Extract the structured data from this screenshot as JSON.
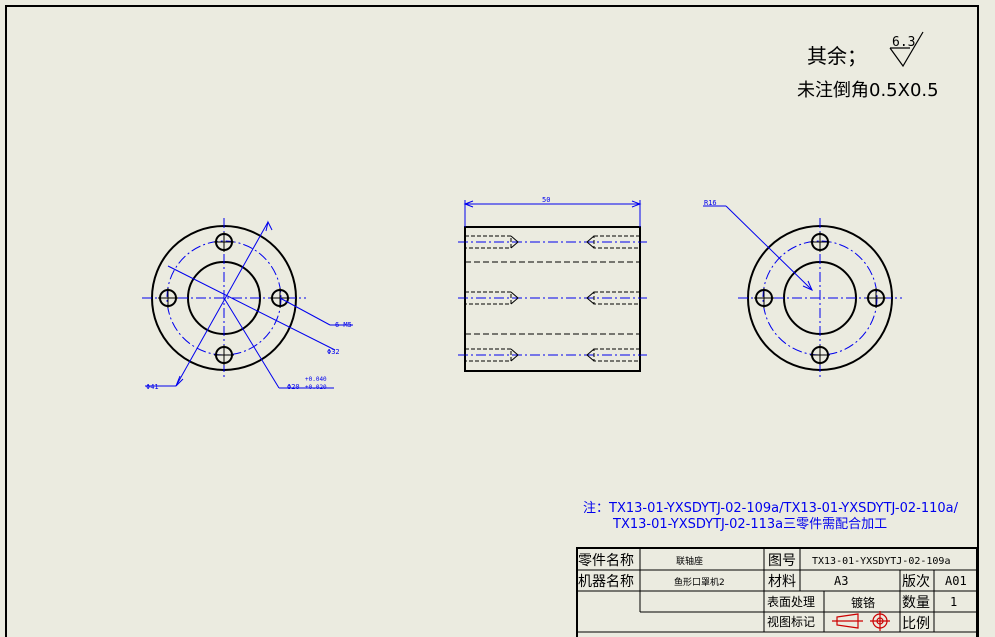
{
  "notes": {
    "roughness_prefix": "其余；",
    "roughness_value": "6.3",
    "chamfer_note": "未注倒角0.5X0.5",
    "note_line1": "注：TX13-01-YXSDYTJ-02-109a/TX13-01-YXSDYTJ-02-110a/",
    "note_line2": "TX13-01-YXSDYTJ-02-113a三零件需配合加工"
  },
  "dimensions": {
    "length": "50",
    "thread": "6-M5",
    "phi32": "Φ32",
    "phi41": "Φ41",
    "phi20": "Φ20",
    "tol_upper": "+0.040",
    "tol_lower": "+0.020",
    "r16": "R16"
  },
  "title_block": {
    "part_name_label": "零件名称",
    "part_name_value": "联轴座",
    "drawing_no_label": "图号",
    "drawing_no_value": "TX13-01-YXSDYTJ-02-109a",
    "machine_name_label": "机器名称",
    "machine_name_value": "鱼形口罩机2",
    "material_label": "材料",
    "material_value": "A3",
    "version_label": "版次",
    "version_value": "A01",
    "surface_label": "表面处理",
    "surface_value": "镀铬",
    "quantity_label": "数量",
    "quantity_value": "1",
    "view_mark_label": "视图标记",
    "scale_label": "比例",
    "scale_value": ""
  }
}
